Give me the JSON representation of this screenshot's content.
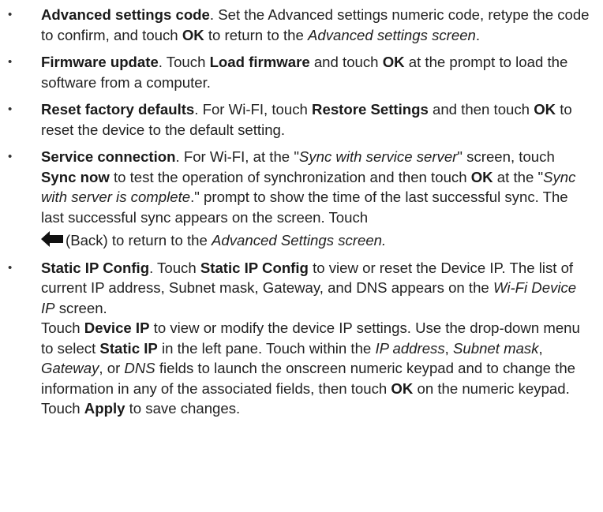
{
  "bullet_glyph": "•",
  "items": [
    {
      "title": "Advanced settings code",
      "s1": ". Set the Advanced settings numeric code, retype the code to confirm, and touch ",
      "b1": "OK",
      "s2": " to return to the ",
      "i1": "Advanced settings screen",
      "s3": "."
    },
    {
      "title": "Firmware update",
      "s1": ". Touch ",
      "b1": "Load firmware",
      "s2": " and touch ",
      "b2": "OK",
      "s3": " at the prompt to load the software from a computer."
    },
    {
      "title": "Reset factory defaults",
      "s1": ". For Wi-FI, touch ",
      "b1": "Restore Settings",
      "s2": " and then touch ",
      "b2": "OK",
      "s3": " to reset the device to the default setting."
    },
    {
      "title": "Service connection",
      "s1": ". For Wi-FI, at the \"",
      "i1": "Sync with service server",
      "s2": "\" screen, touch ",
      "b1": "Sync now",
      "s3": " to test the operation of synchronization and then touch ",
      "b2": "OK",
      "s4": " at the \"",
      "i2": "Sync with server is complete",
      "s5": ".\" prompt to show the time of the last successful sync. The last successful sync appears on the screen. Touch",
      "back_label": "(Back) to return to the ",
      "i3": "Advanced Settings screen.",
      "back_icon": "back-arrow-icon"
    },
    {
      "title": "Static IP Config",
      "s1": ". Touch ",
      "b1": "Static IP Config",
      "s2": " to view or reset the Device IP. The list of current IP address, Subnet mask, Gateway, and DNS appears on the ",
      "i1": "Wi-Fi Device IP",
      "s3": " screen."
    }
  ],
  "sub": {
    "s1": "Touch ",
    "b1": "Device IP",
    "s2": " to view or modify the device IP settings. Use the drop-down menu to select ",
    "b2": "Static IP",
    "s3": " in the left pane. Touch within the ",
    "i1": "IP address",
    "s4": ", ",
    "i2": "Subnet mask",
    "s5": ", ",
    "i3": "Gateway",
    "s6": ", or ",
    "i4": "DNS",
    "s7": " fields to launch the onscreen numeric keypad and to change the information in any of the associated fields, then touch ",
    "b3": "OK",
    "s8": " on the numeric keypad. Touch ",
    "b4": "Apply",
    "s9": " to save changes."
  }
}
